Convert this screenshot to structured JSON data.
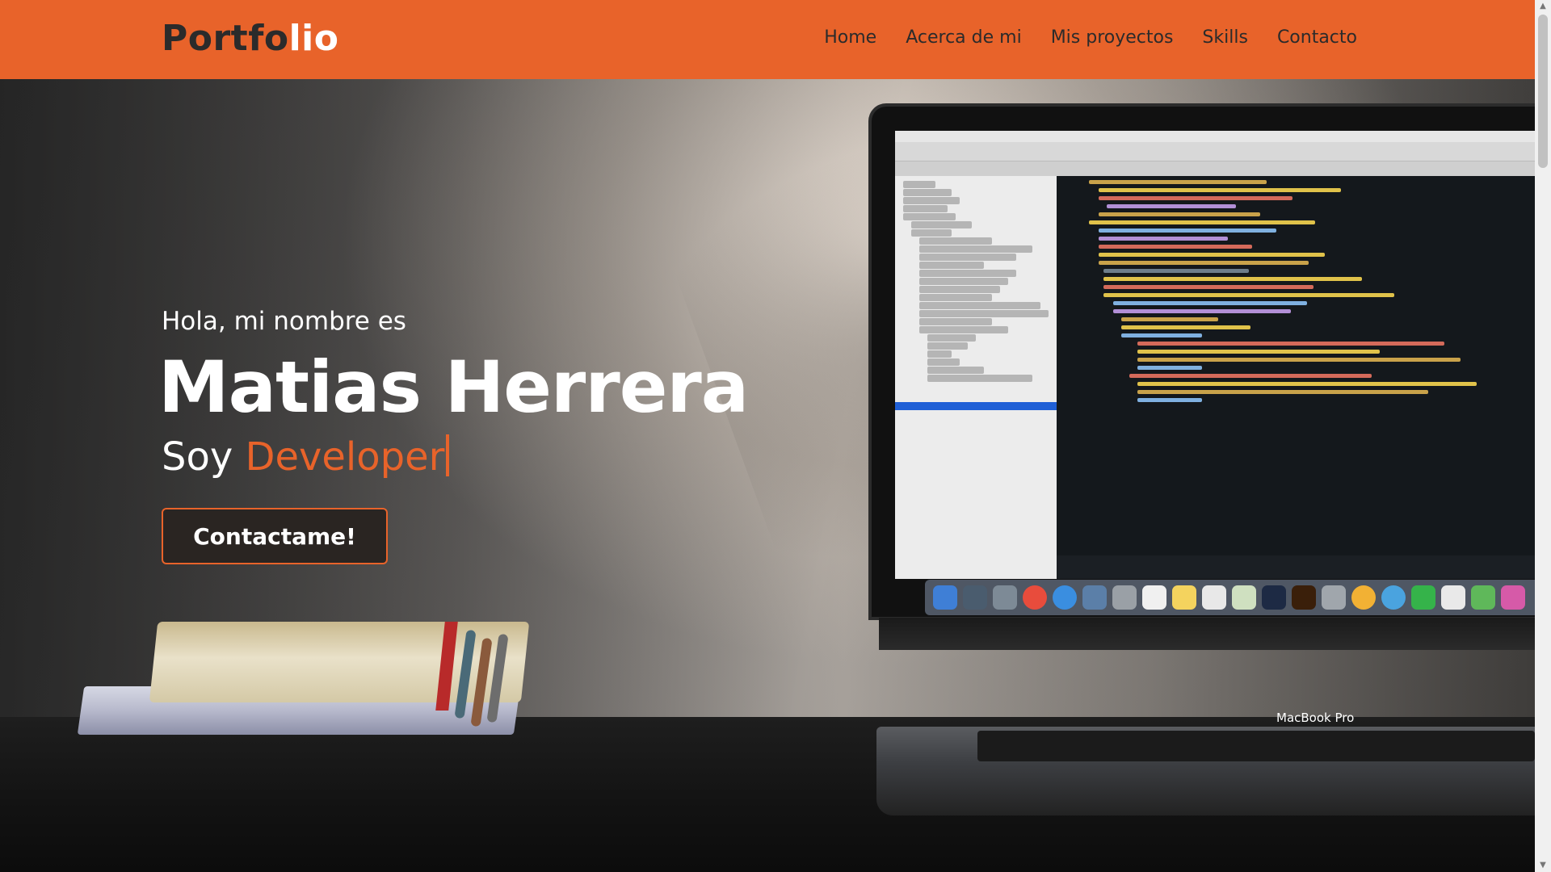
{
  "navbar": {
    "brand_main": "Portfo",
    "brand_accent": "lio",
    "links": [
      "Home",
      "Acerca de mi",
      "Mis proyectos",
      "Skills",
      "Contacto"
    ]
  },
  "hero": {
    "greeting": "Hola, mi nombre es",
    "name": "Matias Herrera",
    "role_prefix": "Soy ",
    "role_word": "Developer",
    "cta_label": "Contactame!",
    "laptop_label": "MacBook Pro"
  },
  "colors": {
    "accent": "#e8632a",
    "text": "#ffffff",
    "nav_text": "#2b2b2b"
  }
}
